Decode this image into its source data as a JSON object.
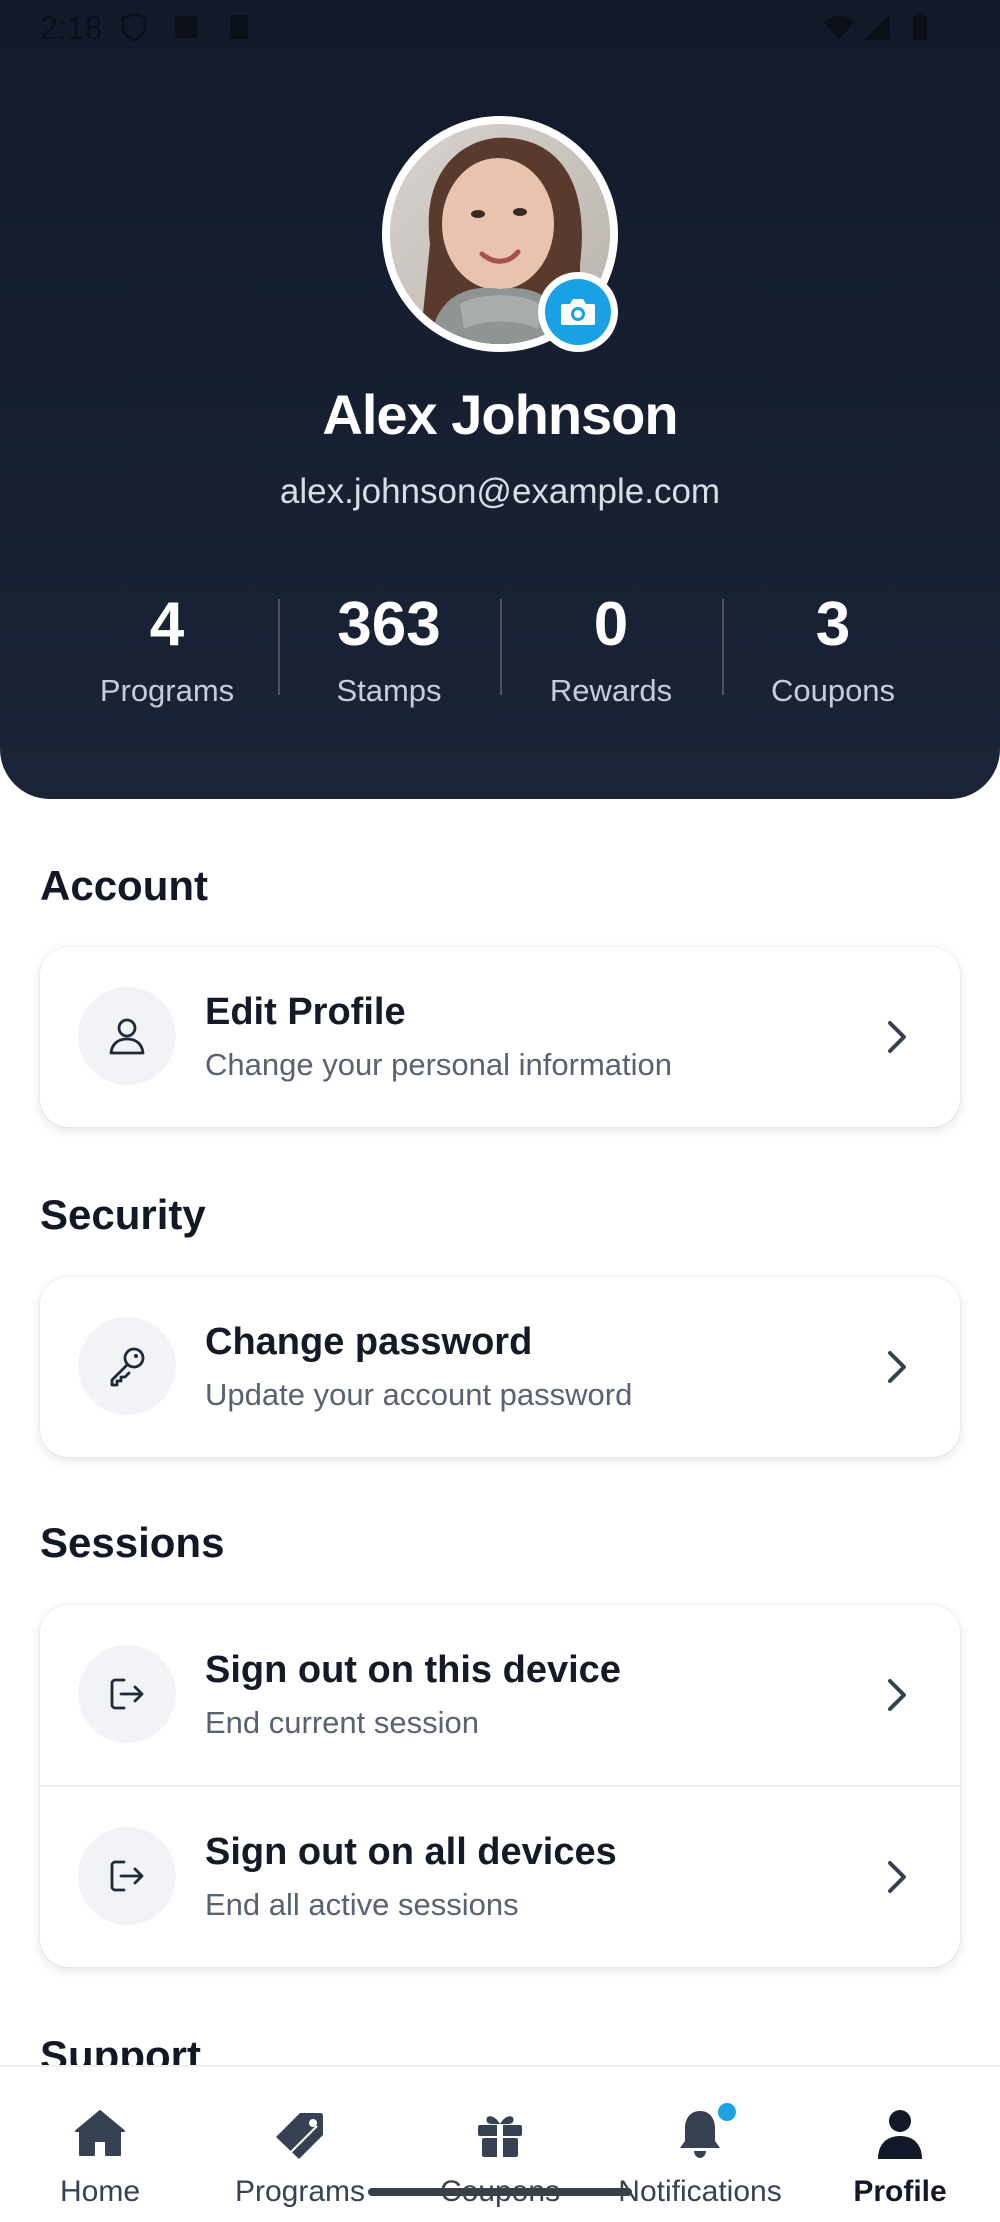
{
  "status_bar": {
    "time": "2:18"
  },
  "profile": {
    "name": "Alex Johnson",
    "email": "alex.johnson@example.com",
    "avatar_icon": "user-photo",
    "camera_icon": "camera-icon"
  },
  "stats": [
    {
      "value": "4",
      "label": "Programs"
    },
    {
      "value": "363",
      "label": "Stamps"
    },
    {
      "value": "0",
      "label": "Rewards"
    },
    {
      "value": "3",
      "label": "Coupons"
    }
  ],
  "sections": {
    "account": {
      "title": "Account",
      "items": [
        {
          "icon": "user-icon",
          "title": "Edit Profile",
          "subtitle": "Change your personal information"
        }
      ]
    },
    "security": {
      "title": "Security",
      "items": [
        {
          "icon": "key-icon",
          "title": "Change password",
          "subtitle": "Update your account password"
        }
      ]
    },
    "sessions": {
      "title": "Sessions",
      "items": [
        {
          "icon": "logout-icon",
          "title": "Sign out on this device",
          "subtitle": "End current session"
        },
        {
          "icon": "logout-icon",
          "title": "Sign out on all devices",
          "subtitle": "End all active sessions"
        }
      ]
    },
    "support": {
      "title": "Support"
    }
  },
  "bottom_nav": {
    "items": [
      {
        "label": "Home",
        "icon": "home-icon",
        "active": false
      },
      {
        "label": "Programs",
        "icon": "tag-icon",
        "active": false
      },
      {
        "label": "Coupons",
        "icon": "gift-icon",
        "active": false
      },
      {
        "label": "Notifications",
        "icon": "bell-icon",
        "active": false,
        "badge": true
      },
      {
        "label": "Profile",
        "icon": "person-icon",
        "active": true
      }
    ]
  },
  "colors": {
    "header_bg": "#121a2a",
    "accent": "#1aa1e4",
    "text_primary": "#141a26",
    "text_secondary": "#596273"
  }
}
